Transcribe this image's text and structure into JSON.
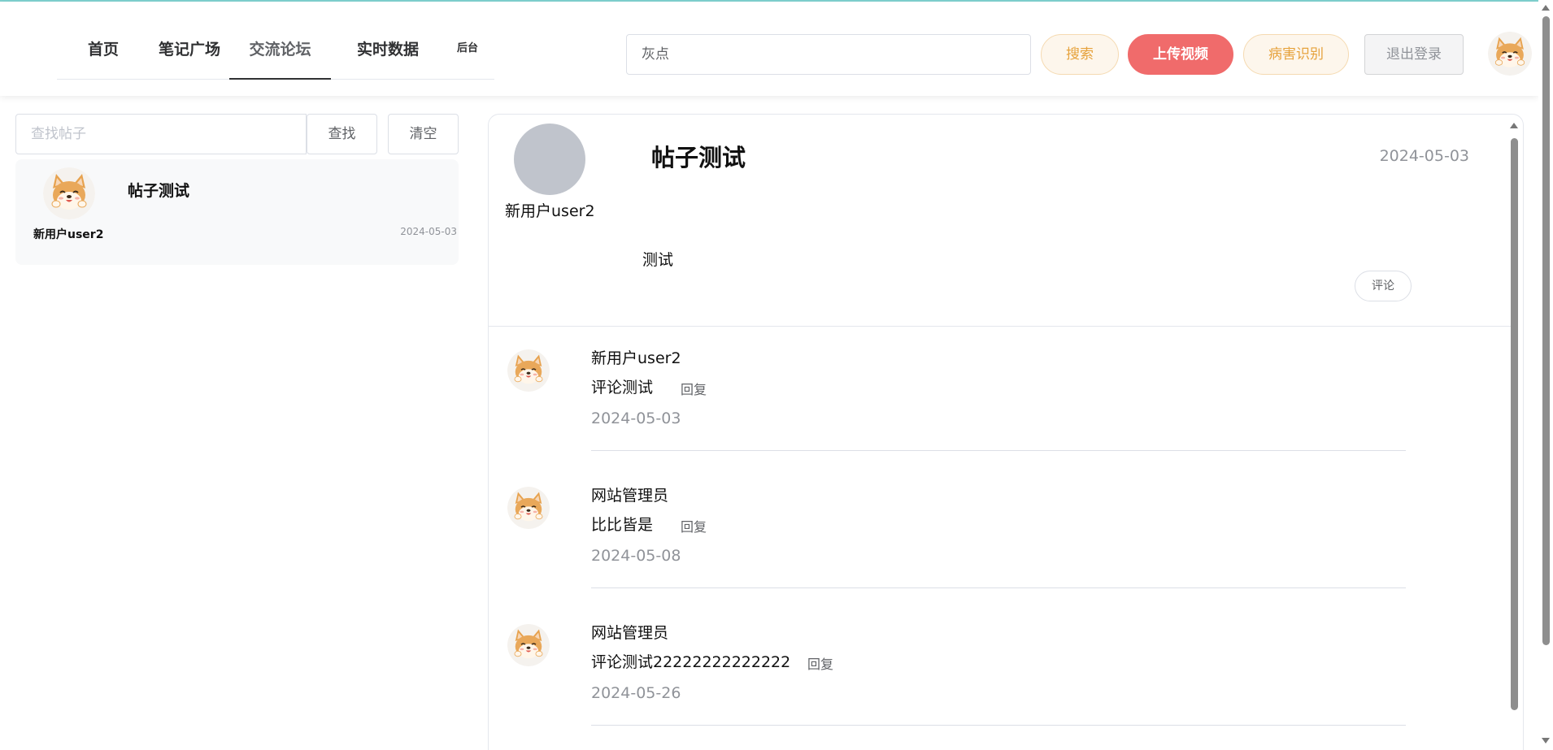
{
  "nav": {
    "items": [
      {
        "label": "首页"
      },
      {
        "label": "笔记广场"
      },
      {
        "label": "交流论坛"
      },
      {
        "label": "实时数据"
      },
      {
        "label": "后台"
      }
    ],
    "active": "交流论坛"
  },
  "header": {
    "search_value": "灰点",
    "search_button": "搜索",
    "upload_button": "上传视频",
    "identify_button": "病害识别",
    "logout_button": "退出登录",
    "avatar_icon": "shiba-avatar-icon"
  },
  "sidebar": {
    "search_placeholder": "查找帖子",
    "find_button": "查找",
    "clear_button": "清空",
    "posts": [
      {
        "title": "帖子测试",
        "author": "新用户user2",
        "date": "2024-05-03"
      }
    ]
  },
  "post": {
    "marks": "``",
    "author": "新用户user2",
    "title": "帖子测试",
    "date": "2024-05-03",
    "content": "测试",
    "comment_button": "评论"
  },
  "comments": [
    {
      "user": "新用户user2",
      "text": "评论测试",
      "reply": "回复",
      "date": "2024-05-03"
    },
    {
      "user": "网站管理员",
      "text": "比比皆是",
      "reply": "回复",
      "date": "2024-05-08"
    },
    {
      "user": "网站管理员",
      "text": "评论测试22222222222222",
      "reply": "回复",
      "date": "2024-05-26"
    }
  ],
  "colors": {
    "danger": "#f06b6b",
    "warning": "#e6a23c",
    "accent_line": "#7fd1cf"
  }
}
